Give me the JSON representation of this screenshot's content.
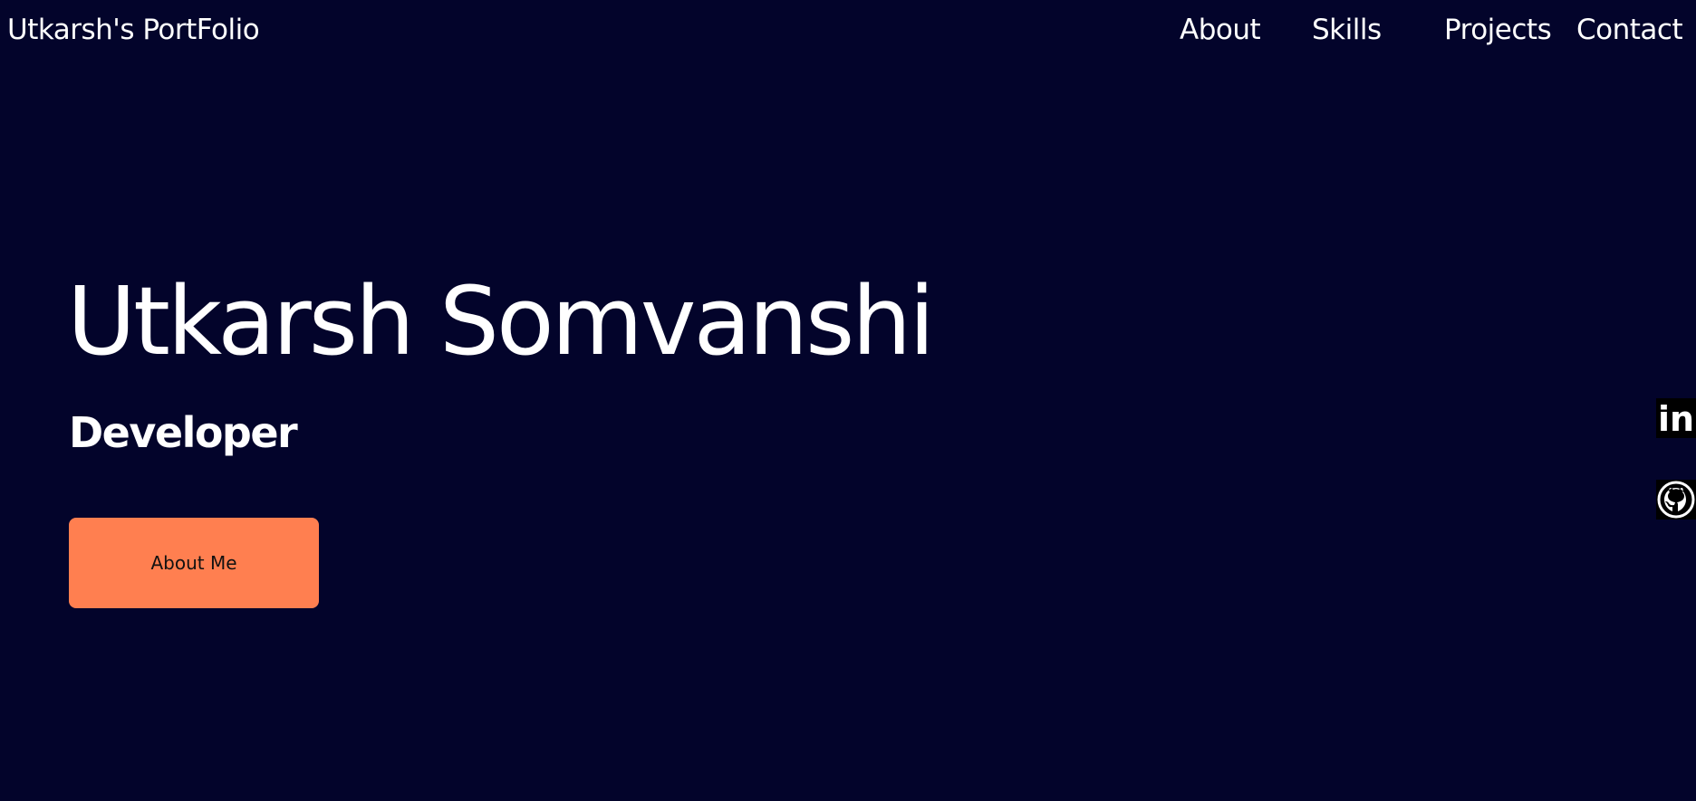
{
  "header": {
    "brand": "Utkarsh's PortFolio",
    "nav": [
      {
        "label": "About"
      },
      {
        "label": "Skills"
      },
      {
        "label": "Projects"
      },
      {
        "label": "Contact"
      }
    ]
  },
  "hero": {
    "name": "Utkarsh Somvanshi",
    "role": "Developer",
    "button_label": "About Me"
  },
  "social": {
    "linkedin_text": "in",
    "icons": [
      "linkedin-icon",
      "github-icon"
    ]
  },
  "colors": {
    "background": "#03042b",
    "accent": "#ff7f50",
    "text": "#ffffff"
  }
}
